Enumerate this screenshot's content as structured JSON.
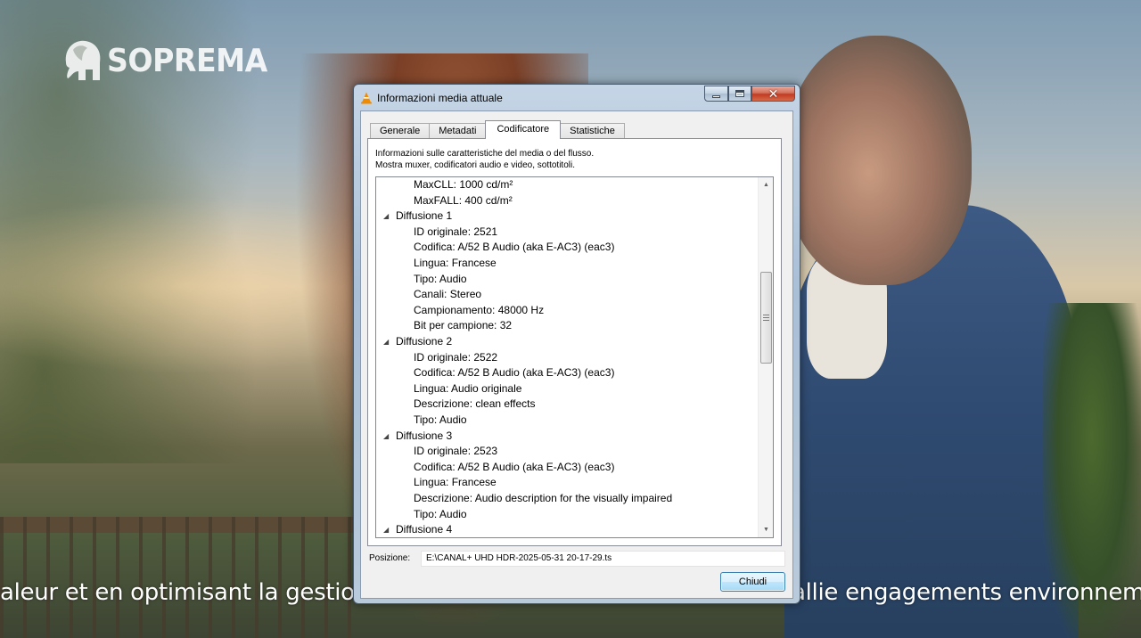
{
  "background": {
    "logo_text": "SOPREMA",
    "subtitle_left": "aleur et en optimisant la gestion",
    "subtitle_right": "allie engagements environneme"
  },
  "window": {
    "title": "Informazioni media attuale",
    "controls": {
      "minimize": "minimize",
      "maximize": "maximize",
      "close": "close"
    }
  },
  "tabs": [
    {
      "label": "Generale",
      "active": false
    },
    {
      "label": "Metadati",
      "active": false
    },
    {
      "label": "Codificatore",
      "active": true
    },
    {
      "label": "Statistiche",
      "active": false
    }
  ],
  "description": {
    "line1": "Informazioni sulle caratteristiche del media o del flusso.",
    "line2": "Mostra muxer, codificatori audio e video, sottotitoli."
  },
  "tree": {
    "rows": [
      {
        "level": 1,
        "text": "MaxCLL: 1000 cd/m²"
      },
      {
        "level": 1,
        "text": "MaxFALL: 400 cd/m²"
      },
      {
        "level": 0,
        "text": "Diffusione 1",
        "expanded": true
      },
      {
        "level": 1,
        "text": "ID originale: 2521"
      },
      {
        "level": 1,
        "text": "Codifica: A/52 B Audio (aka E-AC3) (eac3)"
      },
      {
        "level": 1,
        "text": "Lingua: Francese"
      },
      {
        "level": 1,
        "text": "Tipo: Audio"
      },
      {
        "level": 1,
        "text": "Canali: Stereo"
      },
      {
        "level": 1,
        "text": "Campionamento: 48000 Hz"
      },
      {
        "level": 1,
        "text": "Bit per campione: 32"
      },
      {
        "level": 0,
        "text": "Diffusione 2",
        "expanded": true
      },
      {
        "level": 1,
        "text": "ID originale: 2522"
      },
      {
        "level": 1,
        "text": "Codifica: A/52 B Audio (aka E-AC3) (eac3)"
      },
      {
        "level": 1,
        "text": "Lingua: Audio originale"
      },
      {
        "level": 1,
        "text": "Descrizione: clean effects"
      },
      {
        "level": 1,
        "text": "Tipo: Audio"
      },
      {
        "level": 0,
        "text": "Diffusione 3",
        "expanded": true
      },
      {
        "level": 1,
        "text": "ID originale: 2523"
      },
      {
        "level": 1,
        "text": "Codifica: A/52 B Audio (aka E-AC3) (eac3)"
      },
      {
        "level": 1,
        "text": "Lingua: Francese"
      },
      {
        "level": 1,
        "text": "Descrizione: Audio description for the visually impaired"
      },
      {
        "level": 1,
        "text": "Tipo: Audio"
      },
      {
        "level": 0,
        "text": "Diffusione 4",
        "expanded": true
      }
    ]
  },
  "position": {
    "label": "Posizione:",
    "value": "E:\\CANAL+ UHD HDR-2025-05-31 20-17-29.ts"
  },
  "buttons": {
    "close_label": "Chiudi"
  },
  "colors": {
    "accent": "#3c7fb1",
    "close_red": "#c23b21",
    "vlc_orange": "#f08a00"
  }
}
